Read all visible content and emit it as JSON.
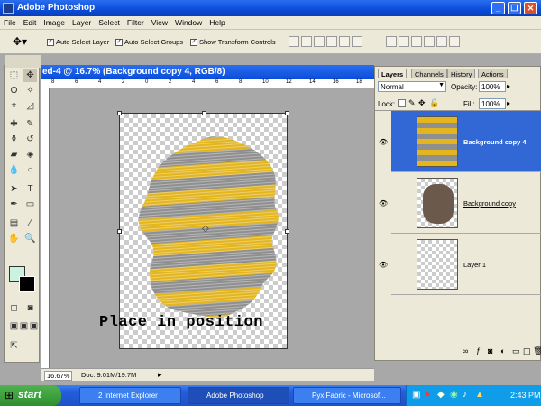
{
  "app": {
    "title": "Adobe Photoshop"
  },
  "menu": [
    "File",
    "Edit",
    "Image",
    "Layer",
    "Select",
    "Filter",
    "View",
    "Window",
    "Help"
  ],
  "options": {
    "auto_select_layer": "Auto Select Layer",
    "auto_select_groups": "Auto Select Groups",
    "show_transform_controls": "Show Transform Controls"
  },
  "document": {
    "title": "ed-4 @ 16.7% (Background copy 4, RGB/8)",
    "caption": "Place in position",
    "zoom": "16.67%",
    "doc_size": "Doc: 9.01M/19.7M",
    "ruler_h": [
      "8",
      "6",
      "4",
      "2",
      "0",
      "2",
      "4",
      "6",
      "8",
      "10",
      "12",
      "14",
      "16",
      "18"
    ]
  },
  "panel": {
    "tabs": [
      "Layers",
      "Channels",
      "History",
      "Actions"
    ],
    "blend_mode": "Normal",
    "opacity_label": "Opacity:",
    "opacity": "100%",
    "lock_label": "Lock:",
    "fill_label": "Fill:",
    "fill": "100%",
    "layers": [
      {
        "name": "Background copy 4",
        "selected": true
      },
      {
        "name": "Background copy",
        "selected": false
      },
      {
        "name": "Layer 1",
        "selected": false
      }
    ]
  },
  "taskbar": {
    "start": "start",
    "tasks": [
      "2 Internet Explorer",
      "Adobe Photoshop",
      "Pyx Fabric - Microsof..."
    ],
    "clock": "2:43 PM"
  },
  "colors": {
    "accent": "#0a4cd9",
    "selected_layer": "#3168d5",
    "fabric_yellow": "#e3b51f",
    "fabric_gray": "#8f8f8f"
  }
}
